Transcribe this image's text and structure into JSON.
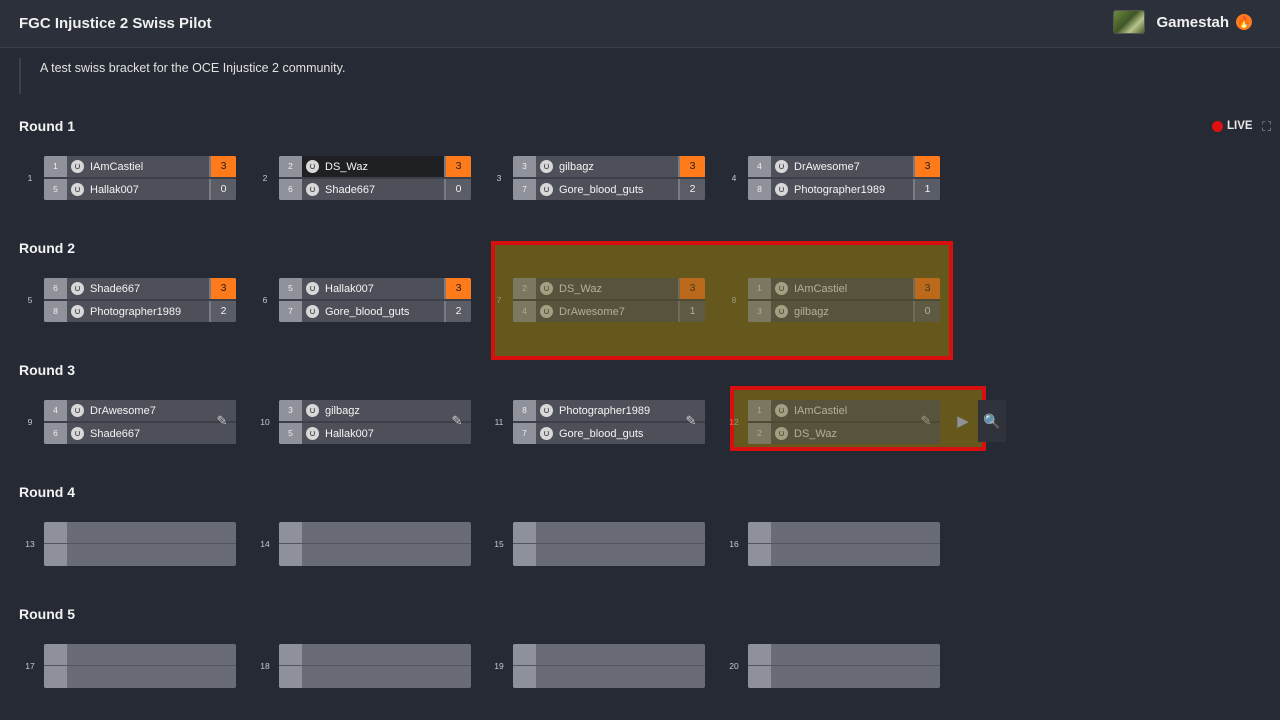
{
  "header": {
    "title": "FGC Injustice 2 Swiss Pilot",
    "username": "Gamestah",
    "flame_glyph": "🔥",
    "caret": "⌄"
  },
  "description": "A test swiss bracket for the OCE Injustice 2 community.",
  "live": {
    "label": "LIVE",
    "dot_color": "#e01010"
  },
  "fullscreen_icon": "⛶",
  "colors": {
    "win_score": "#ff7a1a",
    "highlight_border": "#d80f0f",
    "background": "#262a34"
  },
  "rounds": [
    {
      "title": "Round 1"
    },
    {
      "title": "Round 2"
    },
    {
      "title": "Round 3"
    },
    {
      "title": "Round 4"
    },
    {
      "title": "Round 5"
    }
  ],
  "matches": [
    {
      "num": "1",
      "p1": {
        "seed": "1",
        "name": "IAmCastiel",
        "score": "3"
      },
      "p2": {
        "seed": "5",
        "name": "Hallak007",
        "score": "0"
      }
    },
    {
      "num": "2",
      "p1": {
        "seed": "2",
        "name": "DS_Waz",
        "score": "3"
      },
      "p2": {
        "seed": "6",
        "name": "Shade667",
        "score": "0"
      }
    },
    {
      "num": "3",
      "p1": {
        "seed": "3",
        "name": "gilbagz",
        "score": "3"
      },
      "p2": {
        "seed": "7",
        "name": "Gore_blood_guts",
        "score": "2"
      }
    },
    {
      "num": "4",
      "p1": {
        "seed": "4",
        "name": "DrAwesome7",
        "score": "3"
      },
      "p2": {
        "seed": "8",
        "name": "Photographer1989",
        "score": "1"
      }
    },
    {
      "num": "5",
      "p1": {
        "seed": "6",
        "name": "Shade667",
        "score": "3"
      },
      "p2": {
        "seed": "8",
        "name": "Photographer1989",
        "score": "2"
      }
    },
    {
      "num": "6",
      "p1": {
        "seed": "5",
        "name": "Hallak007",
        "score": "3"
      },
      "p2": {
        "seed": "7",
        "name": "Gore_blood_guts",
        "score": "2"
      }
    },
    {
      "num": "7",
      "p1": {
        "seed": "2",
        "name": "DS_Waz",
        "score": "3"
      },
      "p2": {
        "seed": "4",
        "name": "DrAwesome7",
        "score": "1"
      }
    },
    {
      "num": "8",
      "p1": {
        "seed": "1",
        "name": "IAmCastiel",
        "score": "3"
      },
      "p2": {
        "seed": "3",
        "name": "gilbagz",
        "score": "0"
      }
    },
    {
      "num": "9",
      "p1": {
        "seed": "4",
        "name": "DrAwesome7"
      },
      "p2": {
        "seed": "6",
        "name": "Shade667"
      }
    },
    {
      "num": "10",
      "p1": {
        "seed": "3",
        "name": "gilbagz"
      },
      "p2": {
        "seed": "5",
        "name": "Hallak007"
      }
    },
    {
      "num": "11",
      "p1": {
        "seed": "8",
        "name": "Photographer1989"
      },
      "p2": {
        "seed": "7",
        "name": "Gore_blood_guts"
      }
    },
    {
      "num": "12",
      "p1": {
        "seed": "1",
        "name": "IAmCastiel"
      },
      "p2": {
        "seed": "2",
        "name": "DS_Waz"
      }
    },
    {
      "num": "13"
    },
    {
      "num": "14"
    },
    {
      "num": "15"
    },
    {
      "num": "16"
    },
    {
      "num": "17"
    },
    {
      "num": "18"
    },
    {
      "num": "19"
    },
    {
      "num": "20"
    }
  ],
  "icons": {
    "edit": "✎",
    "play": "▶",
    "search": "🔍"
  }
}
